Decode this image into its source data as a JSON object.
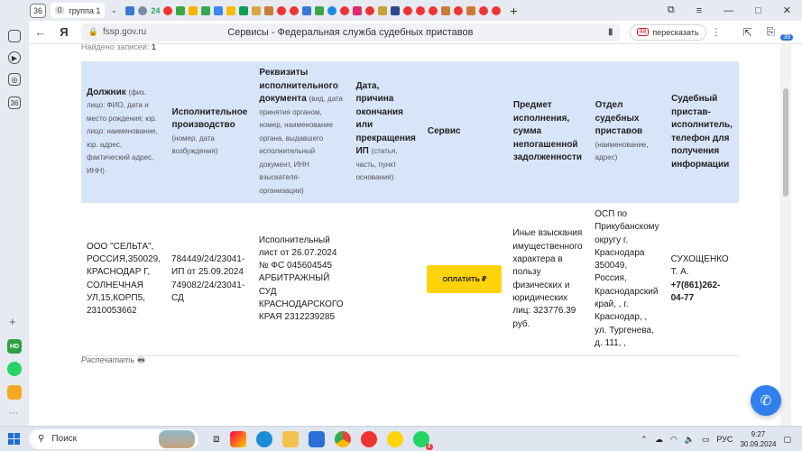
{
  "browser": {
    "tab_count": "36",
    "group": {
      "count": "0",
      "label": "группа 1"
    },
    "favicon_text": "24",
    "url_domain": "fssp.gov.ru",
    "page_title": "Сервисы - Федеральная служба судебных приставов",
    "translate_label": "пересказать",
    "translate_badge": "44",
    "sidebar_badge_36": "36",
    "notif_badge": "39"
  },
  "page": {
    "found_label": "Найдено записей:",
    "found_count": "1",
    "headers": {
      "debtor": "Должник",
      "debtor_note": "(физ. лицо: ФИО, дата и место рождения; юр. лицо: наименование, юр. адрес, фактический адрес, ИНН)",
      "proceeding": "Исполнительное производство",
      "proceeding_note": "(номер, дата возбуждения)",
      "document": "Реквизиты исполнительного документа",
      "document_note": "(вид, дата принятия органом, номер, наименование органа, выдавшего исполнительный документ, ИНН взыскателя-организации)",
      "end": "Дата, причина окончания или прекращения ИП",
      "end_note": "(статья, часть, пункт основания)",
      "service": "Сервис",
      "subject": "Предмет исполнения, сумма непогашенной задолженности",
      "department": "Отдел судебных приставов",
      "department_note": "(наименование, адрес)",
      "bailiff": "Судебный пристав-исполнитель, телефон для получения информации"
    },
    "row": {
      "debtor": "ООО \"СЕЛЬТА\", РОССИЯ,350029, КРАСНОДАР Г, СОЛНЕЧНАЯ УЛ,15,КОРП5, 2310053662",
      "proceeding": "784449/24/23041-ИП от 25.09.2024 749082/24/23041-СД",
      "document": "Исполнительный лист от 26.07.2024 № ФС 045604545 АРБИТРАЖНЫЙ СУД КРАСНОДАРСКОГО КРАЯ 2312239285",
      "end": "",
      "pay_button": "ОПЛАТИТЬ ₽",
      "subject": "Иные взыскания имущественного характера в пользу физических и юридических лиц: 323776.39 руб.",
      "department": "ОСП по Прикубанскому округу г. Краснодара 350049, Россия, Краснодарский край, , г. Краснодар, , ул. Тургенева, д. 111, ,",
      "bailiff_name": "СУХОЩЕНКО Т. А.",
      "bailiff_phone": "+7(861)262-04-77"
    },
    "print_label": "Распечатать"
  },
  "taskbar": {
    "search_label": "Поиск",
    "lang": "РУС",
    "time": "9:27",
    "date": "30.09.2024",
    "hd_badge": "HD",
    "badge_4": "4"
  }
}
